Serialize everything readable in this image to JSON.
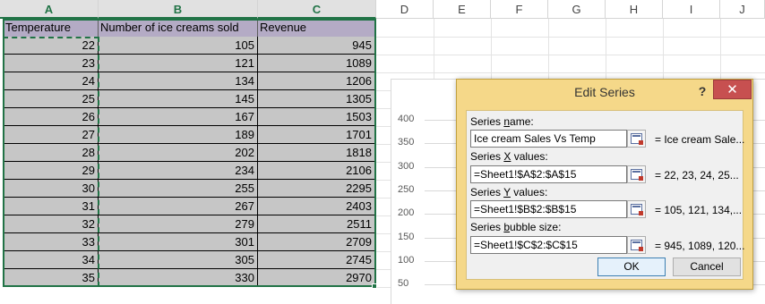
{
  "columns": [
    "A",
    "B",
    "C",
    "D",
    "E",
    "F",
    "G",
    "H",
    "I",
    "J"
  ],
  "table": {
    "headers": [
      "Temperature",
      "Number of ice creams sold",
      "Revenue"
    ],
    "rows": [
      [
        "22",
        "105",
        "945"
      ],
      [
        "23",
        "121",
        "1089"
      ],
      [
        "24",
        "134",
        "1206"
      ],
      [
        "25",
        "145",
        "1305"
      ],
      [
        "26",
        "167",
        "1503"
      ],
      [
        "27",
        "189",
        "1701"
      ],
      [
        "28",
        "202",
        "1818"
      ],
      [
        "29",
        "234",
        "2106"
      ],
      [
        "30",
        "255",
        "2295"
      ],
      [
        "31",
        "267",
        "2403"
      ],
      [
        "32",
        "279",
        "2511"
      ],
      [
        "33",
        "301",
        "2709"
      ],
      [
        "34",
        "305",
        "2745"
      ],
      [
        "35",
        "330",
        "2970"
      ]
    ]
  },
  "chart": {
    "y_ticks": [
      "400",
      "350",
      "300",
      "250",
      "200",
      "150",
      "100",
      "50"
    ]
  },
  "dialog": {
    "title": "Edit Series",
    "help": "?",
    "close": "✕",
    "fields": [
      {
        "label_pre": "Series ",
        "label_u": "n",
        "label_post": "ame:",
        "value": "Ice cream Sales Vs Temp",
        "preview": "= Ice cream Sale..."
      },
      {
        "label_pre": "Series ",
        "label_u": "X",
        "label_post": " values:",
        "value": "=Sheet1!$A$2:$A$15",
        "preview": "= 22, 23, 24, 25..."
      },
      {
        "label_pre": "Series ",
        "label_u": "Y",
        "label_post": " values:",
        "value": "=Sheet1!$B$2:$B$15",
        "preview": "= 105, 121, 134,..."
      },
      {
        "label_pre": "Series ",
        "label_u": "b",
        "label_post": "ubble size:",
        "value": "=Sheet1!$C$2:$C$15",
        "preview": "= 945, 1089, 120..."
      }
    ],
    "ok": "OK",
    "cancel": "Cancel"
  },
  "colors": {
    "header_fill": "#b4abc5",
    "data_fill": "#c6c6c6",
    "selection": "#217346",
    "dialog_frame": "#f5d889",
    "close_button": "#c75050"
  }
}
